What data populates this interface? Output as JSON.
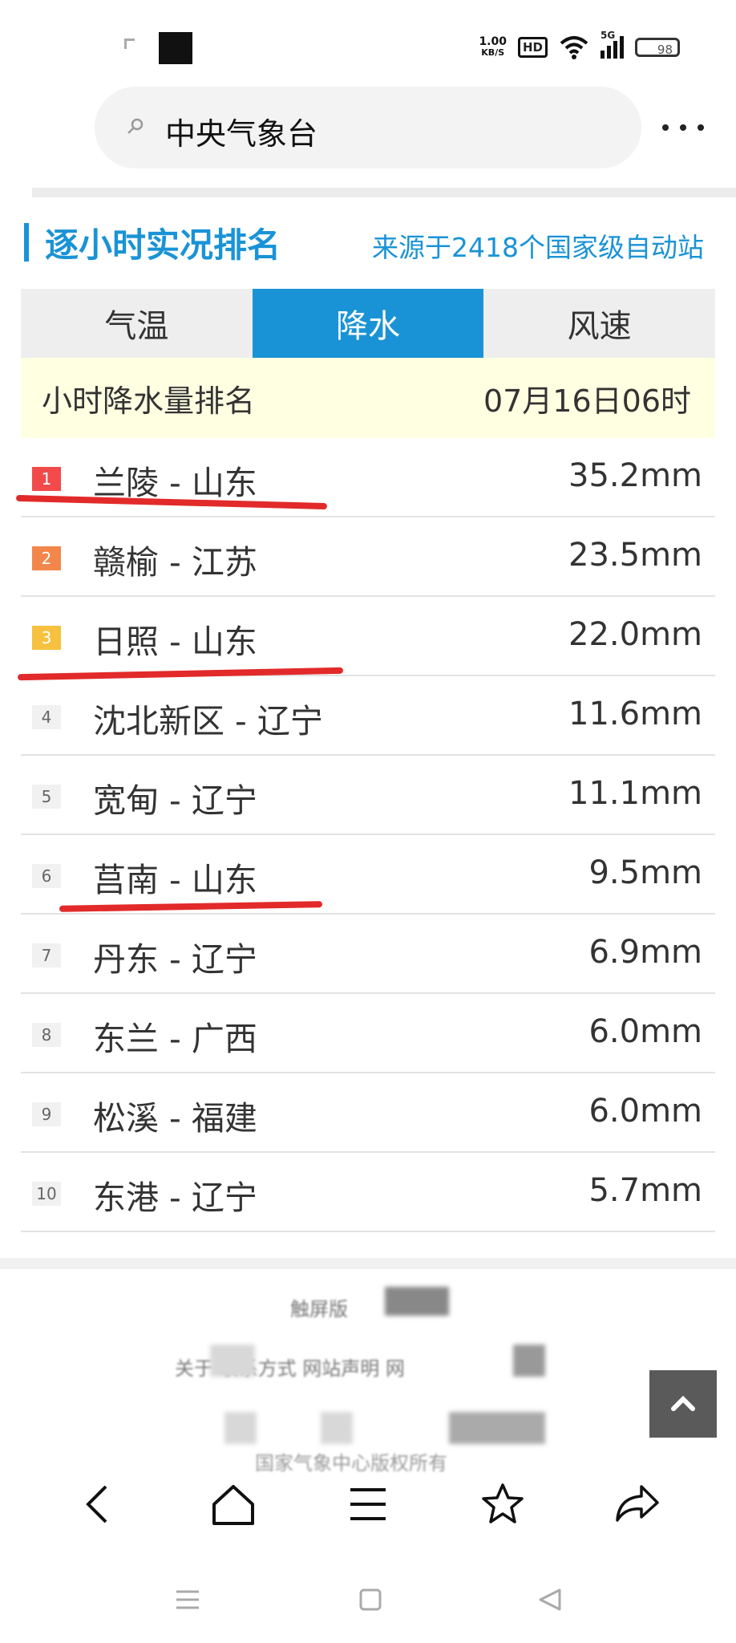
{
  "status": {
    "speed_top": "1.00",
    "speed_unit": "KB/S",
    "hd": "HD",
    "network": "5G",
    "battery": "98"
  },
  "search": {
    "query": "中央气象台"
  },
  "header": {
    "title": "逐小时实况排名",
    "source": "来源于2418个国家级自动站"
  },
  "tabs": [
    {
      "label": "气温",
      "active": false
    },
    {
      "label": "降水",
      "active": true
    },
    {
      "label": "风速",
      "active": false
    }
  ],
  "ranking": {
    "label": "小时降水量排名",
    "time": "07月16日06时",
    "rows": [
      {
        "rank": "1",
        "place": "兰陵 - 山东",
        "value": "35.2mm"
      },
      {
        "rank": "2",
        "place": "赣榆 - 江苏",
        "value": "23.5mm"
      },
      {
        "rank": "3",
        "place": "日照 - 山东",
        "value": "22.0mm"
      },
      {
        "rank": "4",
        "place": "沈北新区 - 辽宁",
        "value": "11.6mm"
      },
      {
        "rank": "5",
        "place": "宽甸 - 辽宁",
        "value": "11.1mm"
      },
      {
        "rank": "6",
        "place": "莒南 - 山东",
        "value": "9.5mm"
      },
      {
        "rank": "7",
        "place": "丹东 - 辽宁",
        "value": "6.9mm"
      },
      {
        "rank": "8",
        "place": "东兰 - 广西",
        "value": "6.0mm"
      },
      {
        "rank": "9",
        "place": "松溪 - 福建",
        "value": "6.0mm"
      },
      {
        "rank": "10",
        "place": "东港 - 辽宁",
        "value": "5.7mm"
      }
    ]
  },
  "footer": {
    "line1": "触屏版",
    "line2": "关于 联系方式 网站声明 网",
    "line3": "国家气象中心版权所有"
  },
  "colors": {
    "accent": "#1a93d6",
    "highlight_row": "#ffffe2",
    "annotation": "#e22a2a"
  }
}
